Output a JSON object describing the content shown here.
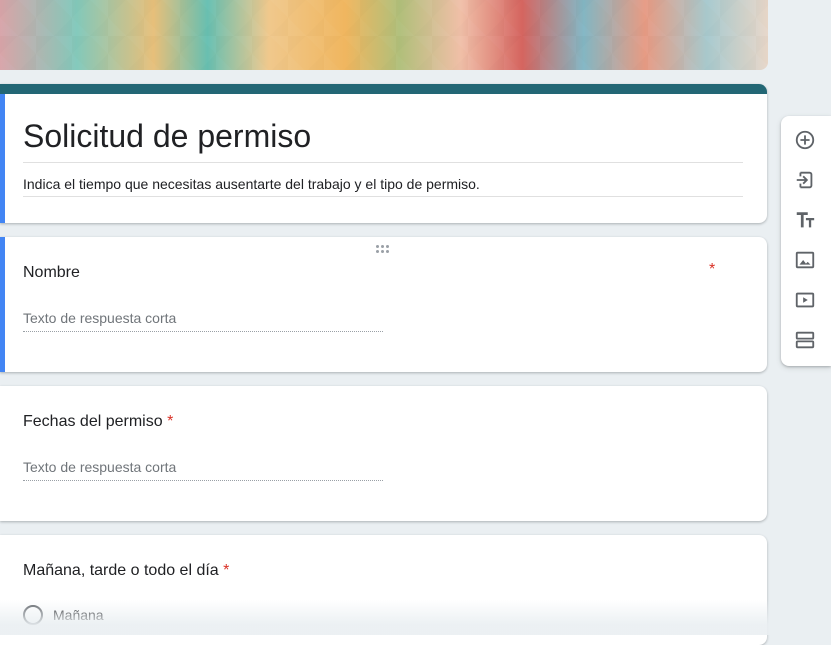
{
  "form": {
    "title": "Solicitud de permiso",
    "description": "Indica el tiempo que necesitas ausentarte del trabajo y el tipo de permiso."
  },
  "questions": [
    {
      "label": "Nombre",
      "required": "*",
      "placeholder": "Texto de respuesta corta"
    },
    {
      "label": "Fechas del permiso",
      "required": "*",
      "placeholder": "Texto de respuesta corta"
    },
    {
      "label": "Mañana, tarde o todo el día",
      "required": "*",
      "options": [
        "Mañana"
      ]
    }
  ],
  "toolbar": {
    "icons": [
      "add-question-icon",
      "import-questions-icon",
      "add-title-icon",
      "add-image-icon",
      "add-video-icon",
      "add-section-icon"
    ]
  },
  "colors": {
    "theme": "#236775",
    "accent": "#4285f4",
    "required": "#d93025"
  }
}
